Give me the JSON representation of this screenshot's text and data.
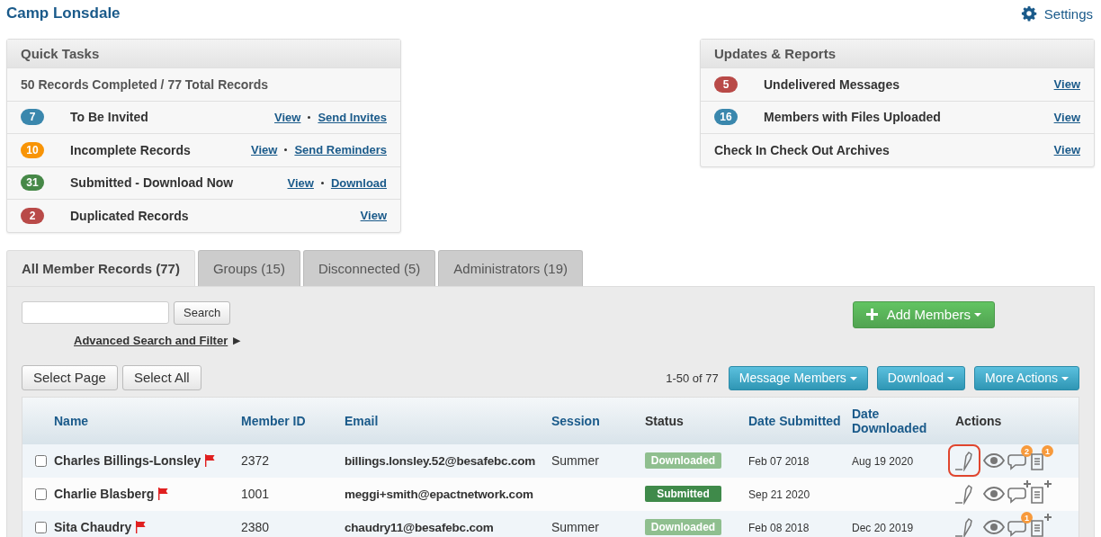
{
  "header": {
    "title": "Camp Lonsdale",
    "settings": "Settings"
  },
  "quick_tasks": {
    "title": "Quick Tasks",
    "summary": "50 Records Completed / 77 Total Records",
    "items": [
      {
        "count": "7",
        "color": "#3a87ad",
        "label": "To Be Invited",
        "links": [
          "View",
          "Send Invites"
        ]
      },
      {
        "count": "10",
        "color": "#f89406",
        "label": "Incomplete Records",
        "links": [
          "View",
          "Send Reminders"
        ]
      },
      {
        "count": "31",
        "color": "#468847",
        "label": "Submitted - Download Now",
        "links": [
          "View",
          "Download"
        ]
      },
      {
        "count": "2",
        "color": "#b94a48",
        "label": "Duplicated Records",
        "links": [
          "View"
        ]
      }
    ]
  },
  "updates": {
    "title": "Updates & Reports",
    "items": [
      {
        "count": "5",
        "color": "#b94a48",
        "label": "Undelivered Messages",
        "links": [
          "View"
        ]
      },
      {
        "count": "16",
        "color": "#3a87ad",
        "label": "Members with Files Uploaded",
        "links": [
          "View"
        ]
      },
      {
        "label": "Check In Check Out Archives",
        "links": [
          "View"
        ]
      }
    ]
  },
  "tabs": [
    {
      "label": "All Member Records (77)",
      "selected": true
    },
    {
      "label": "Groups (15)",
      "selected": false
    },
    {
      "label": "Disconnected (5)",
      "selected": false
    },
    {
      "label": "Administrators (19)",
      "selected": false
    }
  ],
  "search": {
    "button": "Search",
    "advanced": "Advanced Search and Filter",
    "arrow": "▶"
  },
  "add_members": "Add Members",
  "select_buttons": [
    "Select Page",
    "Select All"
  ],
  "pagination": "1-50 of 77",
  "action_buttons": [
    "Message Members",
    "Download",
    "More Actions"
  ],
  "table": {
    "columns": [
      {
        "label": "Name",
        "sortable": true
      },
      {
        "label": "Member ID",
        "sortable": true
      },
      {
        "label": "Email",
        "sortable": true
      },
      {
        "label": "Session",
        "sortable": true
      },
      {
        "label": "Status",
        "sortable": false
      },
      {
        "label": "Date Submitted",
        "sortable": true
      },
      {
        "label": "Date Downloaded",
        "sortable": true
      },
      {
        "label": "Actions",
        "sortable": false
      }
    ],
    "rows": [
      {
        "checked": false,
        "name": "Charles Billings-Lonsley",
        "flagged": true,
        "member_id": "2372",
        "email": "billings.lonsley.52@besafebc.com",
        "session": "Summer",
        "status": {
          "label": "Downloaded",
          "kind": "downloaded"
        },
        "date_submitted": "Feb 07 2018",
        "date_downloaded": "Aug 19 2020",
        "comments": "2",
        "notes": "1",
        "highlighted": true
      },
      {
        "checked": false,
        "name": "Charlie Blasberg",
        "flagged": true,
        "member_id": "1001",
        "email": "meggi+smith@epactnetwork.com",
        "status": {
          "label": "Submitted",
          "kind": "submitted"
        },
        "date_submitted": "Sep 21 2020",
        "highlighted": false
      },
      {
        "checked": false,
        "name": "Sita Chaudry",
        "flagged": true,
        "member_id": "2380",
        "email": "chaudry11@besafebc.com",
        "session": "Summer",
        "status": {
          "label": "Downloaded",
          "kind": "downloaded"
        },
        "date_submitted": "Feb 08 2018",
        "date_downloaded": "Dec 20 2019",
        "comments": "1",
        "highlighted": false
      }
    ]
  }
}
